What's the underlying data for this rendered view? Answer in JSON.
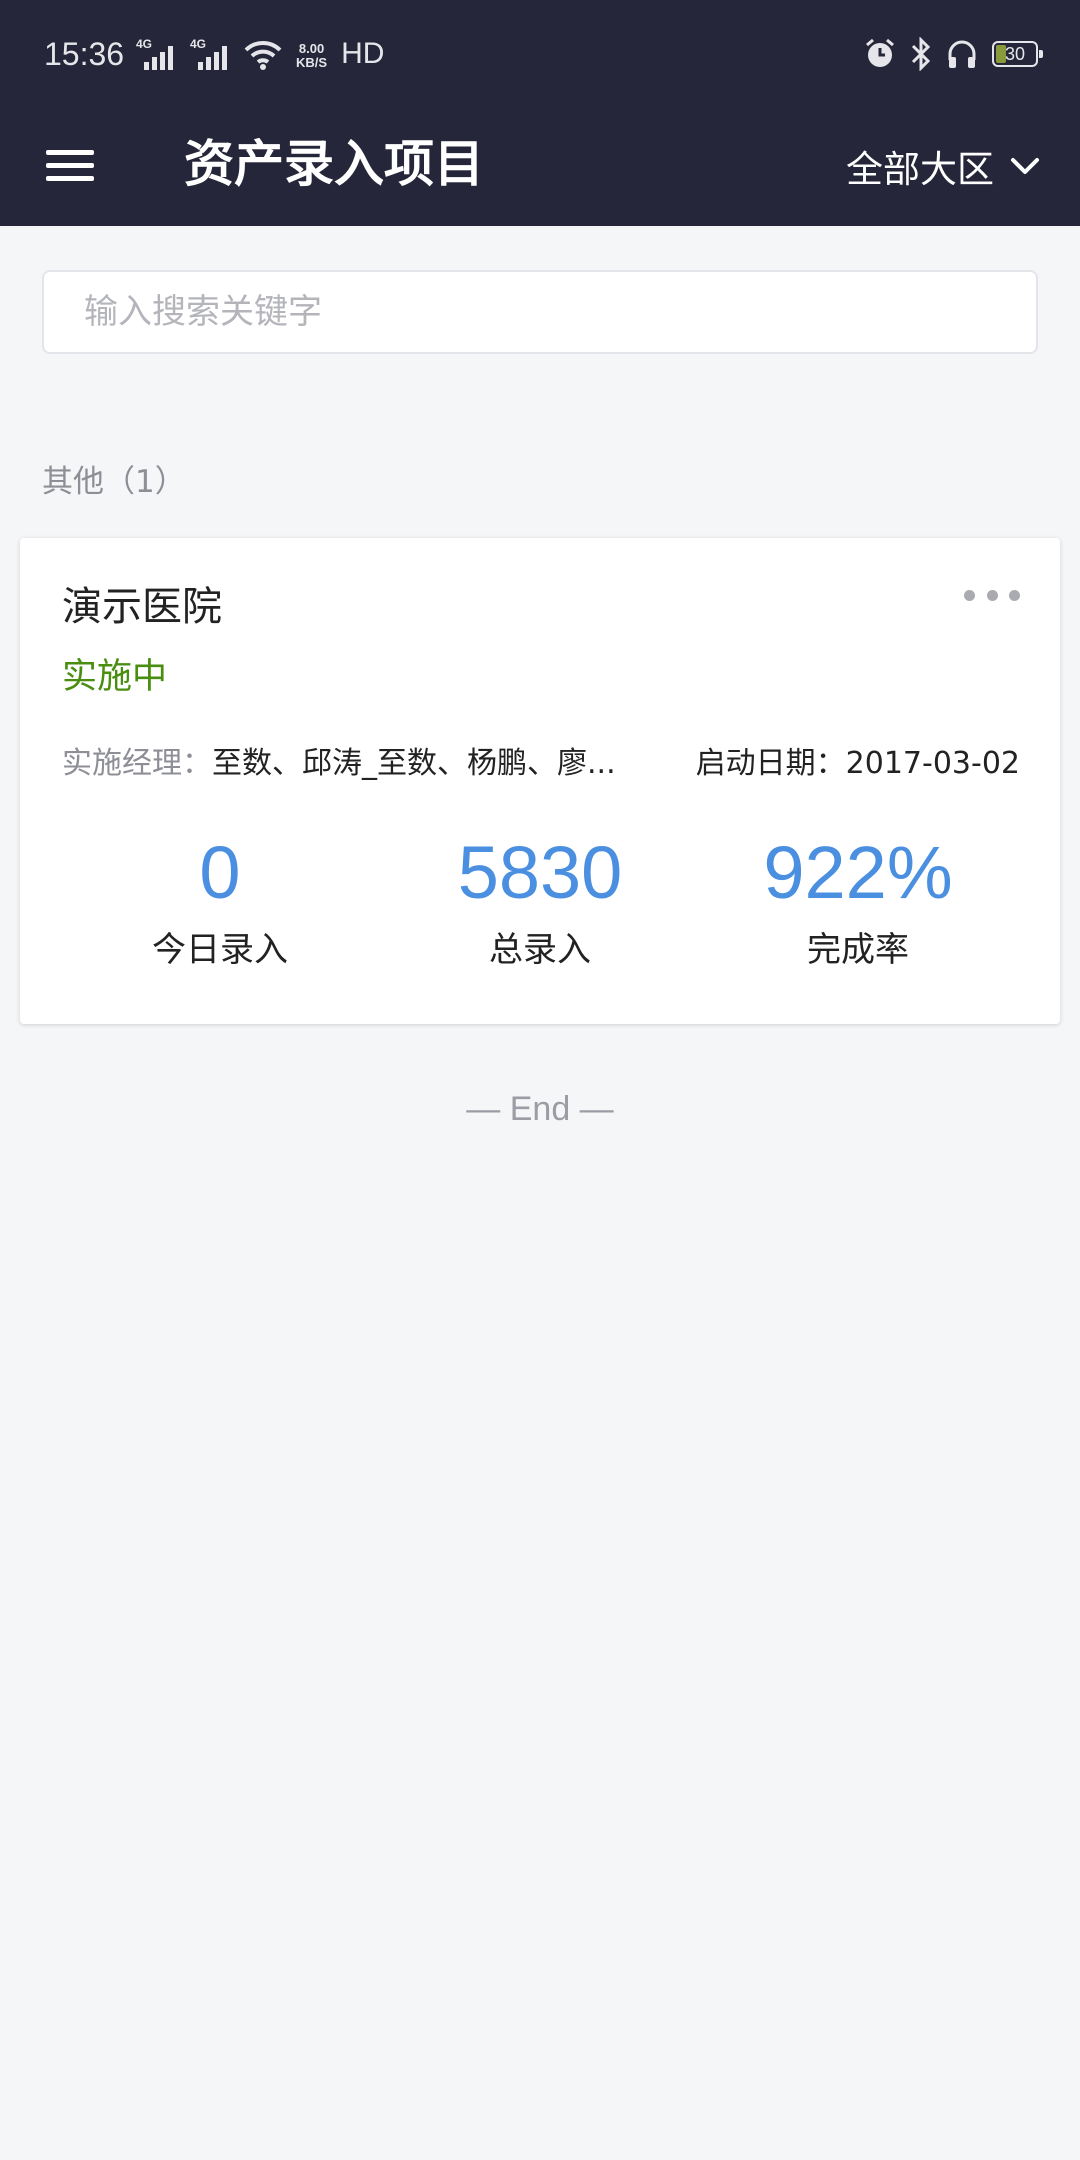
{
  "status_bar": {
    "time": "15:36",
    "network_speed": "8.00\nKB/S",
    "hd_label": "HD",
    "battery_level": "30",
    "icons": [
      "signal-4g-icon",
      "signal-4g-icon",
      "wifi-icon",
      "alarm-icon",
      "bluetooth-icon",
      "headphones-icon",
      "battery-icon"
    ]
  },
  "header": {
    "title": "资产录入项目",
    "region_select": "全部大区",
    "menu_icon": "hamburger-menu-icon"
  },
  "search": {
    "placeholder": "输入搜索关键字"
  },
  "groups": [
    {
      "title": "其他（1）",
      "projects": [
        {
          "name": "演示医院",
          "status": "实施中",
          "status_color": "#4a8e10",
          "manager_label": "实施经理：",
          "manager_value": "至数、邱涛_至数、杨鹏、廖...",
          "start_date_label": "启动日期：",
          "start_date": "2017-03-02",
          "stats": [
            {
              "value": "0",
              "label": "今日录入"
            },
            {
              "value": "5830",
              "label": "总录入"
            },
            {
              "value": "922%",
              "label": "完成率"
            }
          ]
        }
      ]
    }
  ],
  "end_marker": "— End —",
  "colors": {
    "header_bg": "#252639",
    "page_bg": "#f5f6f8",
    "stat_value": "#4a8fe0",
    "status_green": "#4a8e10"
  }
}
